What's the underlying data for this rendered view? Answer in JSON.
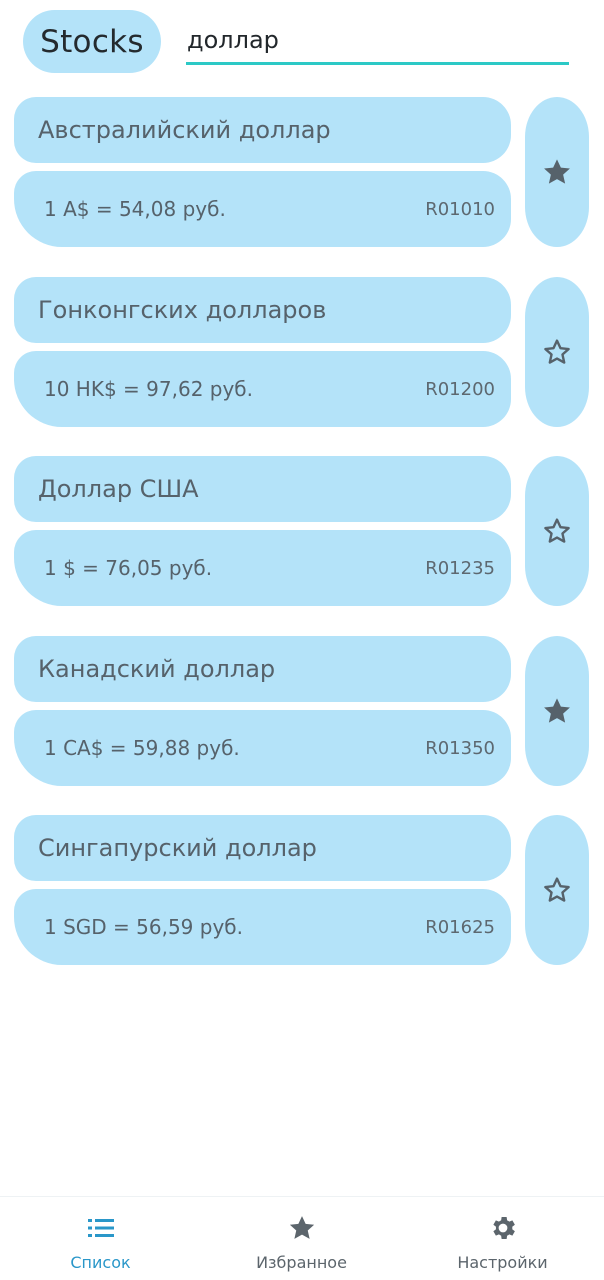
{
  "header": {
    "title": "Stocks",
    "search_value": "доллар"
  },
  "currencies": [
    {
      "name": "Австралийский доллар",
      "rate": "1 A$ = 54,08 руб.",
      "code": "R01010",
      "favorite": true
    },
    {
      "name": "Гонконгских долларов",
      "rate": "10 HK$ = 97,62 руб.",
      "code": "R01200",
      "favorite": false
    },
    {
      "name": "Доллар США",
      "rate": "1 $ = 76,05 руб.",
      "code": "R01235",
      "favorite": false
    },
    {
      "name": "Канадский доллар",
      "rate": "1 CA$ = 59,88 руб.",
      "code": "R01350",
      "favorite": true
    },
    {
      "name": "Сингапурский доллар",
      "rate": "1 SGD = 56,59 руб.",
      "code": "R01625",
      "favorite": false
    }
  ],
  "nav": {
    "list_label": "Список",
    "favorites_label": "Избранное",
    "settings_label": "Настройки",
    "active": "list"
  },
  "colors": {
    "accent": "#2a97c9",
    "pill": "#b4e3f9",
    "search_underline": "#2cc9c6",
    "icon": "#56626b"
  },
  "icons": {
    "favorite_on": "star-filled-icon",
    "favorite_off": "star-outline-icon",
    "list": "list-icon",
    "favorites": "star-icon",
    "settings": "gear-icon"
  }
}
